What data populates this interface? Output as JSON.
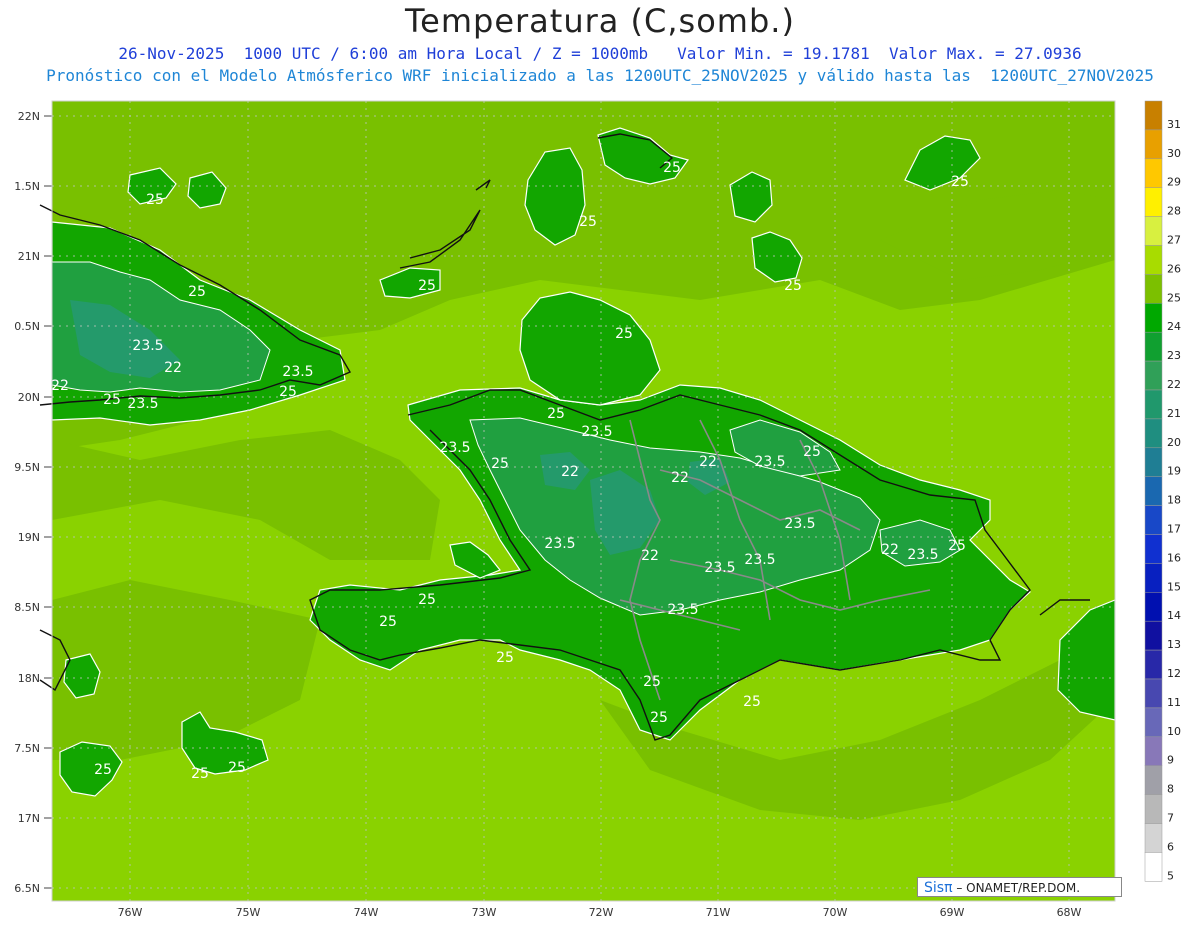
{
  "header": {
    "title": "Temperatura (C,somb.)",
    "line1": "26-Nov-2025  1000 UTC / 6:00 am Hora Local / Z = 1000mb   Valor Min. = 19.1781  Valor Max. = 27.0936",
    "line2": "Pronóstico con el Modelo Atmósferico WRF inicializado a las 1200UTC_25NOV2025 y válido hasta las  1200UTC_27NOV2025"
  },
  "axes": {
    "lat_labels": [
      "22N",
      "1.5N",
      "21N",
      "0.5N",
      "20N",
      "9.5N",
      "19N",
      "8.5N",
      "18N",
      "7.5N",
      "17N",
      "6.5N"
    ],
    "lon_labels": [
      "76W",
      "75W",
      "74W",
      "73W",
      "72W",
      "71W",
      "70W",
      "69W",
      "68W"
    ]
  },
  "colorbar": {
    "labels": [
      "31",
      "30",
      "29",
      "28",
      "27",
      "26",
      "25",
      "24",
      "23",
      "22",
      "21",
      "20",
      "19",
      "18",
      "17",
      "16",
      "15",
      "14",
      "13",
      "12",
      "11",
      "10",
      "9",
      "8",
      "7",
      "6",
      "5"
    ],
    "colors": [
      "#c88000",
      "#e8a000",
      "#ffc800",
      "#fff000",
      "#d8f040",
      "#a8dc00",
      "#7cc000",
      "#00a800",
      "#10a030",
      "#30a058",
      "#20986c",
      "#1f8e80",
      "#1f7e94",
      "#1a68b0",
      "#1848c8",
      "#1030d0",
      "#0820c0",
      "#0010b0",
      "#1010a0",
      "#2828a8",
      "#4848b0",
      "#6868b8",
      "#8878b8",
      "#a0a0a8",
      "#b8b8b8",
      "#d4d4d4",
      "#ffffff"
    ]
  },
  "contour_labels": [
    {
      "t": "25"
    },
    {
      "t": "25"
    },
    {
      "t": "25"
    },
    {
      "t": "25"
    },
    {
      "t": "25"
    },
    {
      "t": "25"
    },
    {
      "t": "25"
    },
    {
      "t": "25"
    },
    {
      "t": "23.5"
    },
    {
      "t": "22"
    },
    {
      "t": "23.5"
    },
    {
      "t": "22"
    },
    {
      "t": "25"
    },
    {
      "t": "23.5"
    },
    {
      "t": "25"
    },
    {
      "t": "25"
    },
    {
      "t": "23.5"
    },
    {
      "t": "25"
    },
    {
      "t": "23.5"
    },
    {
      "t": "22"
    },
    {
      "t": "22"
    },
    {
      "t": "22"
    },
    {
      "t": "23.5"
    },
    {
      "t": "25"
    },
    {
      "t": "23.5"
    },
    {
      "t": "22"
    },
    {
      "t": "23.5"
    },
    {
      "t": "23.5"
    },
    {
      "t": "23.5"
    },
    {
      "t": "22"
    },
    {
      "t": "23.5"
    },
    {
      "t": "25"
    },
    {
      "t": "23.5"
    },
    {
      "t": "25"
    },
    {
      "t": "25"
    },
    {
      "t": "25"
    },
    {
      "t": "25"
    },
    {
      "t": "25"
    },
    {
      "t": "25"
    },
    {
      "t": "25"
    },
    {
      "t": "25"
    },
    {
      "t": "25"
    }
  ],
  "credit": {
    "logo": "Sisπ",
    "text": " – ONAMET/REP.DOM."
  }
}
